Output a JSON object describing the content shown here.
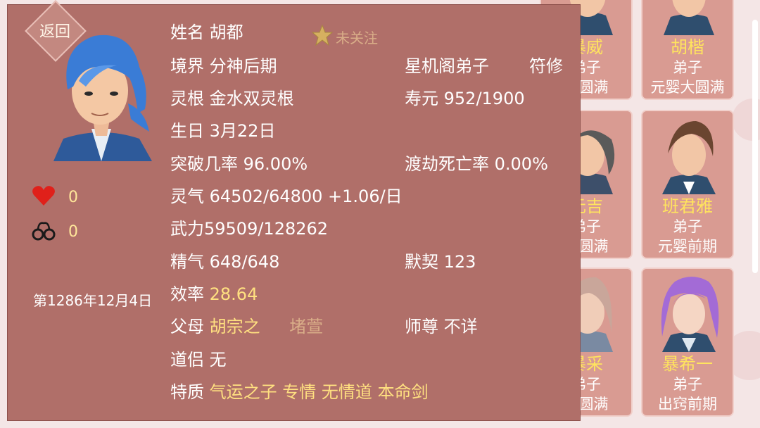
{
  "colors": {
    "panel_bg": "#b06f69",
    "card_bg": "#d99b92",
    "highlight": "#ffe080",
    "muted": "#d9ad88",
    "text": "#ffffff"
  },
  "roster": [
    {
      "name": "暴威",
      "role": "弟子",
      "realm": "大圆满"
    },
    {
      "name": "胡楷",
      "role": "弟子",
      "realm": "元婴大圆满"
    },
    {
      "name": "元吉",
      "role": "弟子",
      "realm": "大圆满"
    },
    {
      "name": "班君雅",
      "role": "弟子",
      "realm": "元婴前期"
    },
    {
      "name": "暴采",
      "role": "弟子",
      "realm": "大圆满"
    },
    {
      "name": "暴希一",
      "role": "弟子",
      "realm": "出窍前期"
    }
  ],
  "panel": {
    "back_label": "返回",
    "follow_label": "未关注",
    "heart_count": "0",
    "cuffs_count": "0",
    "date": "第1286年12月4日",
    "name_label": "姓名",
    "name_value": "胡都",
    "realm_label": "境界",
    "realm_value": "分神后期",
    "sect": "星机阁弟子",
    "profession": "符修",
    "root_label": "灵根",
    "root_value": "金水双灵根",
    "lifespan_label": "寿元",
    "lifespan_value": "952/1900",
    "birthday_label": "生日",
    "birthday_value": "3月22日",
    "breakthrough_label": "突破几率",
    "breakthrough_value": "96.00%",
    "tribulation_label": "渡劫死亡率",
    "tribulation_value": "0.00%",
    "qi_label": "灵气",
    "qi_value": "64502/64800 +1.06/日",
    "force_label": "武力",
    "force_value": "59509/128262",
    "essence_label": "精气",
    "essence_value": "648/648",
    "rapport_label": "默契",
    "rapport_value": "123",
    "efficiency_label": "效率",
    "efficiency_value": "28.64",
    "parents_label": "父母",
    "father": "胡宗之",
    "mother": "堵萱",
    "master_label": "师尊",
    "master_value": "不详",
    "partner_label": "道侣",
    "partner_value": "无",
    "traits_label": "特质",
    "traits": [
      "气运之子",
      "专情",
      "无情道",
      "本命剑"
    ]
  }
}
